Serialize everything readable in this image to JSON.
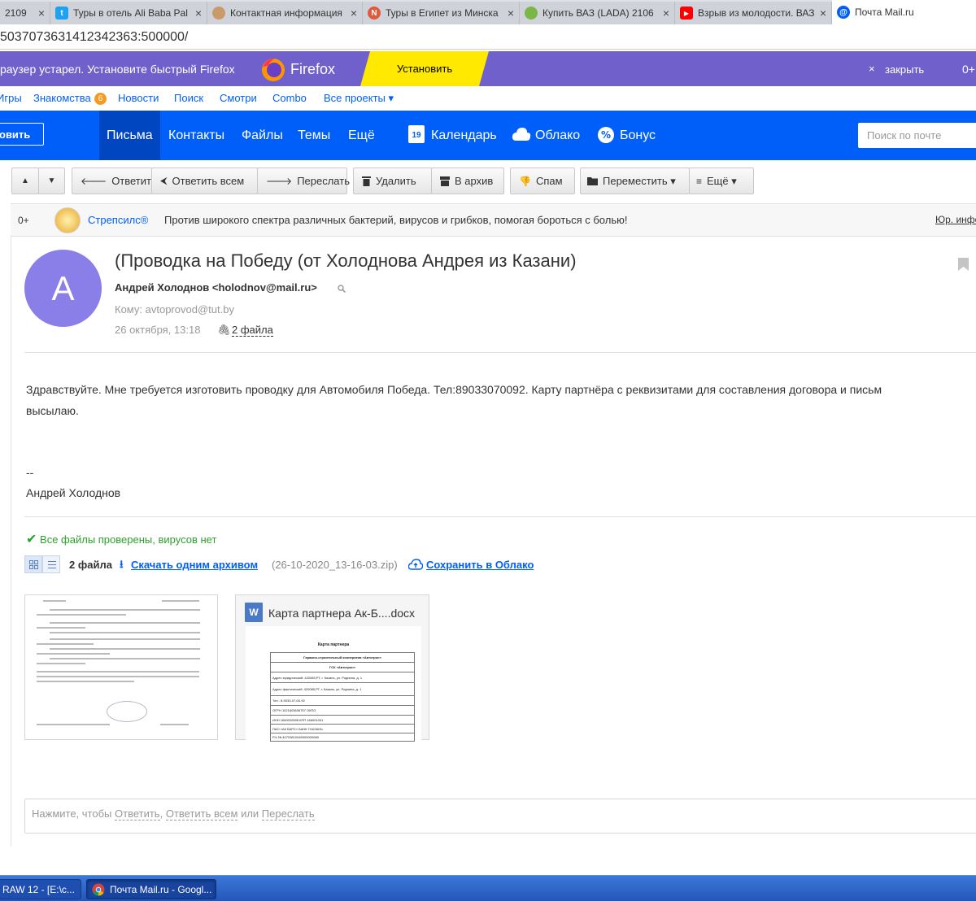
{
  "browser": {
    "tabs": [
      {
        "label": "2109 ",
        "favicon_color": "#ffffff"
      },
      {
        "label": "Туры в отель Ali Baba Pal",
        "favicon_color": "#1da1f2",
        "favicon_glyph": "t"
      },
      {
        "label": "Контактная информация",
        "favicon_color": "#c99a6a"
      },
      {
        "label": "Туры в Египет из Минска",
        "favicon_color": "#e0593a",
        "favicon_glyph": "N"
      },
      {
        "label": "Купить ВАЗ (LADA) 2106",
        "favicon_color": "#7ab648"
      },
      {
        "label": "Взрыв из молодости. ВАЗ",
        "favicon_color": "#ff0000",
        "favicon_glyph": "▶"
      },
      {
        "label": "Почта Mail.ru",
        "favicon_color": "#005ff9",
        "favicon_glyph": "@"
      }
    ],
    "close_glyph": "×",
    "address": "5037073631412342363:500000/"
  },
  "firefox_banner": {
    "message": "раузер устарел. Установите быстрый Firefox",
    "brand": "Firefox",
    "install_label": "Установить",
    "close_glyph": "×",
    "close_label": "закрыть",
    "right_text": "0+"
  },
  "portal_menu": {
    "items": [
      {
        "label": "Игры"
      },
      {
        "label": "Знакомства"
      },
      {
        "label": "Новости"
      },
      {
        "label": "Поиск"
      },
      {
        "label": "Смотри"
      },
      {
        "label": "Combo"
      },
      {
        "label": "Все проекты ▾"
      }
    ],
    "badge": "6"
  },
  "header": {
    "write_label": "овить",
    "nav": [
      {
        "label": "Письма"
      },
      {
        "label": "Контакты"
      },
      {
        "label": "Файлы"
      },
      {
        "label": "Темы"
      },
      {
        "label": "Ещё"
      },
      {
        "label": "Календарь"
      },
      {
        "label": "Облако"
      },
      {
        "label": "Бонус"
      }
    ],
    "calendar_day": "19",
    "search_placeholder": "Поиск по почте"
  },
  "toolbar": {
    "up": "▲",
    "down": "▼",
    "reply": "Ответить",
    "reply_all": "Ответить всем",
    "forward": "Переслать",
    "delete": "Удалить",
    "archive": "В архив",
    "spam": "Спам",
    "move": "Переместить ▾",
    "more": "Ещё ▾"
  },
  "ad": {
    "age": "0+",
    "brand": "Стрепсилс®",
    "text": "Против широкого спектра различных бактерий, вирусов и грибков, помогая бороться с болью!",
    "legal": "Юр. инфо"
  },
  "message": {
    "avatar_letter": "А",
    "subject": "(Проводка на Победу (от Холоднова Андрея из Казани)",
    "sender": "Андрей Холоднов <holodnov@mail.ru>",
    "to_label": "Кому:",
    "to": "avtoprovod@tut.by",
    "date": "26 октября, 13:18",
    "files_count": "2 файла",
    "body_line1": "Здравствуйте. Мне требуется изготовить проводку для Автомобиля Победа. Тел:89033070092. Карту партнёра с реквизитами для составления договора и письм",
    "body_line2": "высылаю.",
    "signature_dash": "--",
    "signature_name": "Андрей Холоднов"
  },
  "attachments": {
    "virus_check": "Все файлы проверены, вирусов нет",
    "count_label": "2 файла",
    "download_archive": "Скачать одним архивом",
    "archive_name": "(26-10-2020_13-16-03.zip)",
    "save_cloud": "Сохранить в Облако",
    "docx_name": "Карта партнера Ак-Б....docx",
    "docx_title": "Карта партнера",
    "docx_rows": [
      "Гаражно-строительный кооператив «Автотрон»",
      "ГСК «Автотрон»",
      "Адрес юридический: 420085,РТ, г. Казань, ул. Роднина, д. 1",
      "Адрес фактический: 420085,РТ, г. Казань, ул. Роднина, д. 1",
      "Тел.: 8-9033-07-00-92",
      "ОГРН 1021603636757 ОКПО",
      "ИНН 1660020598 КПП 166001001",
      "ПАО «АК БАРС» БАНК Г.КАЗАНЬ",
      "Р/с № 40703810945000000068"
    ]
  },
  "reply_box": {
    "prefix": "Нажмите, чтобы",
    "reply": "Ответить",
    "reply_all": "Ответить всем",
    "or": "или",
    "forward": "Переслать"
  },
  "taskbar": {
    "item1": "RAW 12 - [E:\\c...",
    "item2": "Почта Mail.ru - Googl..."
  }
}
